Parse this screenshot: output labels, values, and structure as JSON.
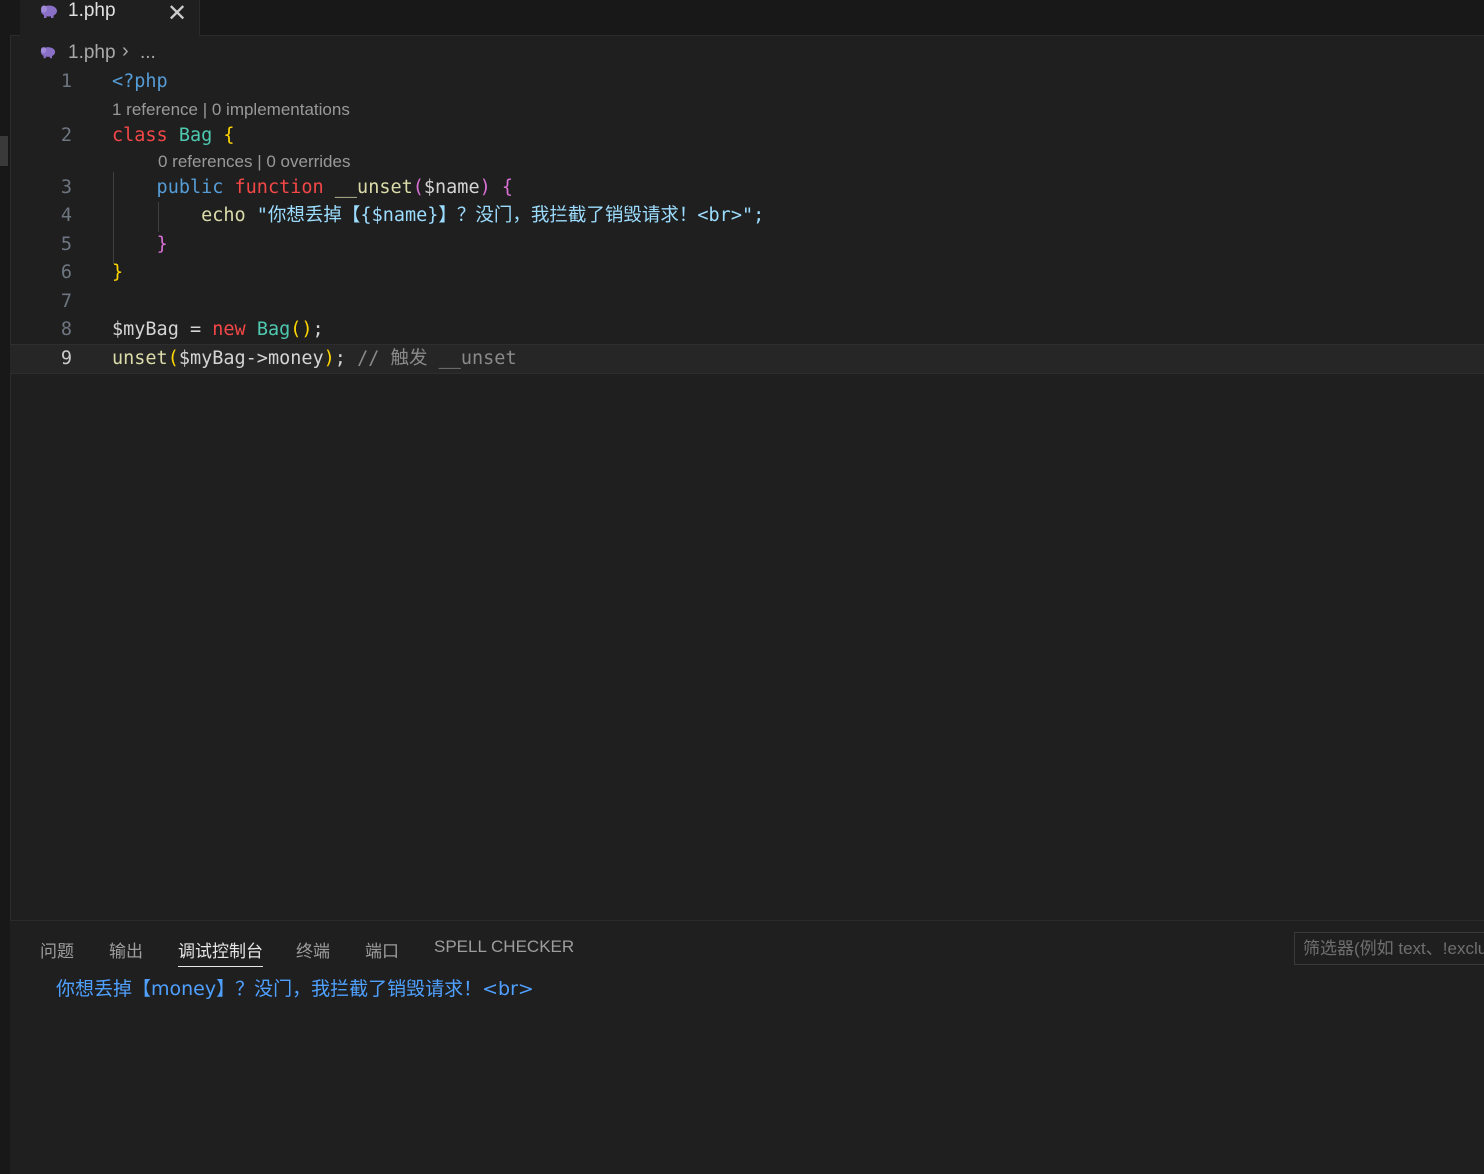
{
  "tabs": [
    {
      "label": "1.php",
      "icon": "php-elephant-icon",
      "close_icon": "✕"
    }
  ],
  "breadcrumb": {
    "file": "1.php",
    "separator": "›",
    "more": "..."
  },
  "editor": {
    "lines": [
      {
        "n": "1",
        "tokens": [
          {
            "t": "<?php",
            "c": "k-tag"
          }
        ]
      },
      {
        "n": "2",
        "tokens": [
          {
            "t": "class ",
            "c": "k-red"
          },
          {
            "t": "Bag",
            "c": "k-class"
          },
          {
            "t": " ",
            "c": "plain"
          },
          {
            "t": "{",
            "c": "p1"
          }
        ]
      },
      {
        "n": "3",
        "tokens": [
          {
            "t": "    public ",
            "c": "k-blue"
          },
          {
            "t": "function ",
            "c": "k-red"
          },
          {
            "t": "__unset",
            "c": "k-func"
          },
          {
            "t": "(",
            "c": "p2"
          },
          {
            "t": "$name",
            "c": "k-var"
          },
          {
            "t": ")",
            "c": "p2"
          },
          {
            "t": " ",
            "c": "plain"
          },
          {
            "t": "{",
            "c": "p2"
          }
        ]
      },
      {
        "n": "4",
        "tokens": [
          {
            "t": "        echo ",
            "c": "k-func"
          },
          {
            "t": "\"你想丢掉【{$name}】？没门，我拦截了销毁请求！<br>\";",
            "c": "k-str"
          }
        ]
      },
      {
        "n": "5",
        "tokens": [
          {
            "t": "    ",
            "c": "plain"
          },
          {
            "t": "}",
            "c": "p2"
          }
        ]
      },
      {
        "n": "6",
        "tokens": [
          {
            "t": "}",
            "c": "p1"
          }
        ]
      },
      {
        "n": "7",
        "tokens": []
      },
      {
        "n": "8",
        "tokens": [
          {
            "t": "$myBag",
            "c": "k-var"
          },
          {
            "t": " = ",
            "c": "plain"
          },
          {
            "t": "new ",
            "c": "k-red"
          },
          {
            "t": "Bag",
            "c": "k-class"
          },
          {
            "t": "()",
            "c": "p1"
          },
          {
            "t": ";",
            "c": "plain"
          }
        ]
      },
      {
        "n": "9",
        "tokens": [
          {
            "t": "unset",
            "c": "k-func"
          },
          {
            "t": "(",
            "c": "p1"
          },
          {
            "t": "$myBag->money",
            "c": "k-var"
          },
          {
            "t": ")",
            "c": "p1"
          },
          {
            "t": "; ",
            "c": "plain"
          },
          {
            "t": "// 触发 __unset",
            "c": "k-comment"
          }
        ]
      }
    ],
    "codelens": [
      {
        "text": "1 reference | 0 implementations"
      },
      {
        "text": "0 references | 0 overrides"
      }
    ],
    "current_line": "9"
  },
  "panel": {
    "tabs": [
      "问题",
      "输出",
      "调试控制台",
      "终端",
      "端口",
      "SPELL CHECKER"
    ],
    "active_tab": "调试控制台",
    "filter_placeholder": "筛选器(例如 text、!exclude)",
    "output": "你想丢掉【money】？没门，我拦截了销毁请求！<br>"
  },
  "colors": {
    "background": "#1f1f1f",
    "keyword_red": "#f44747",
    "class_teal": "#4ec9b0",
    "string_blue": "#9cdcfe",
    "console_output": "#4fa0ff"
  }
}
